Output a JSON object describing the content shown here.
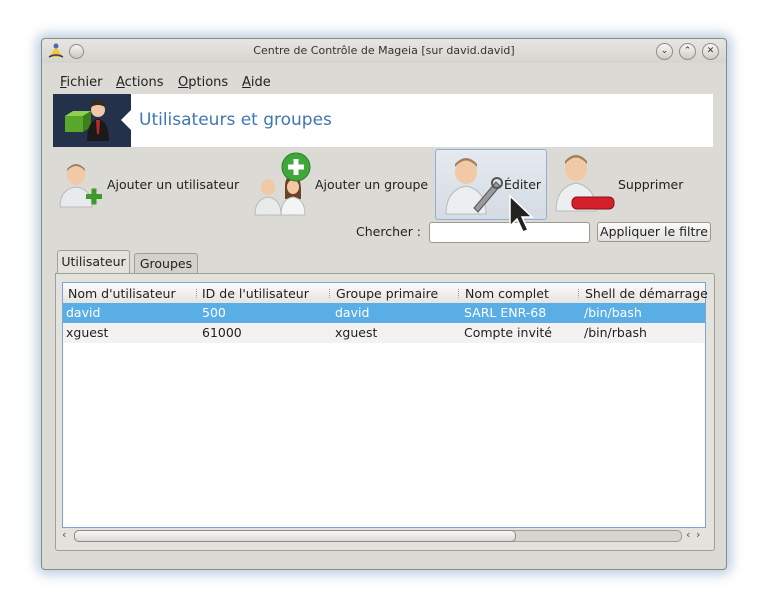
{
  "window": {
    "title": "Centre de Contrôle de Mageia  [sur david.david]"
  },
  "menubar": {
    "items": [
      {
        "accel": "F",
        "rest": "ichier"
      },
      {
        "accel": "A",
        "rest": "ctions"
      },
      {
        "accel": "O",
        "rest": "ptions"
      },
      {
        "accel": "A",
        "rest": "ide"
      }
    ]
  },
  "banner": {
    "title": "Utilisateurs et groupes"
  },
  "toolbar": {
    "add_user": "Ajouter un utilisateur",
    "add_group": "Ajouter un groupe",
    "edit": "Éditer",
    "delete": "Supprimer"
  },
  "filter": {
    "label": "Chercher :",
    "value": "",
    "button": "Appliquer le filtre"
  },
  "tabs": [
    "Utilisateur",
    "Groupes"
  ],
  "table": {
    "columns": [
      "Nom d'utilisateur",
      "ID de l'utilisateur",
      "Groupe primaire",
      "Nom complet",
      "Shell de démarrage"
    ],
    "rows": [
      [
        "david",
        "500",
        "david",
        "SARL ENR-68",
        "/bin/bash"
      ],
      [
        "xguest",
        "61000",
        "xguest",
        "Compte invité",
        "/bin/rbash"
      ]
    ],
    "selected_row": 0
  },
  "colors": {
    "selection": "#5aaee6",
    "banner_title": "#3f77b3",
    "window_bg": "#dcdad5"
  },
  "icons": [
    "mageia-app-icon",
    "add-user-icon",
    "add-group-icon",
    "edit-user-icon",
    "delete-user-icon",
    "minimize-icon",
    "maximize-icon",
    "close-icon",
    "mouse-pointer-icon"
  ]
}
